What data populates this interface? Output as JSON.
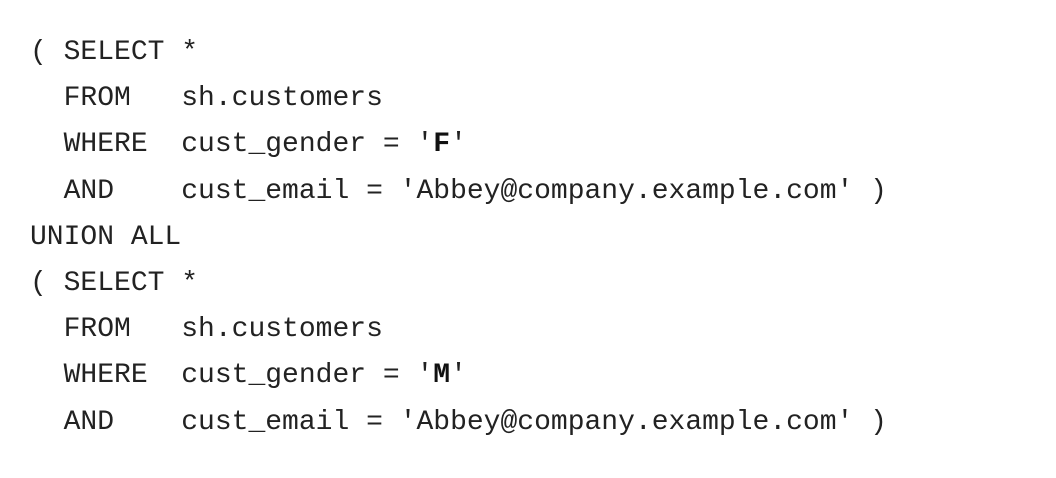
{
  "sql": {
    "block1": {
      "open": "( SELECT *",
      "from_kw": "  FROM   ",
      "from_table": "sh.customers",
      "where_kw": "  WHERE  ",
      "where_pre": "cust_gender = '",
      "where_val": "F",
      "where_post": "'",
      "and_kw": "  AND    ",
      "and_expr": "cust_email = 'Abbey@company.example.com' )"
    },
    "union": "UNION ALL",
    "block2": {
      "open": "( SELECT *",
      "from_kw": "  FROM   ",
      "from_table": "sh.customers",
      "where_kw": "  WHERE  ",
      "where_pre": "cust_gender = '",
      "where_val": "M",
      "where_post": "'",
      "and_kw": "  AND    ",
      "and_expr": "cust_email = 'Abbey@company.example.com' )"
    }
  }
}
